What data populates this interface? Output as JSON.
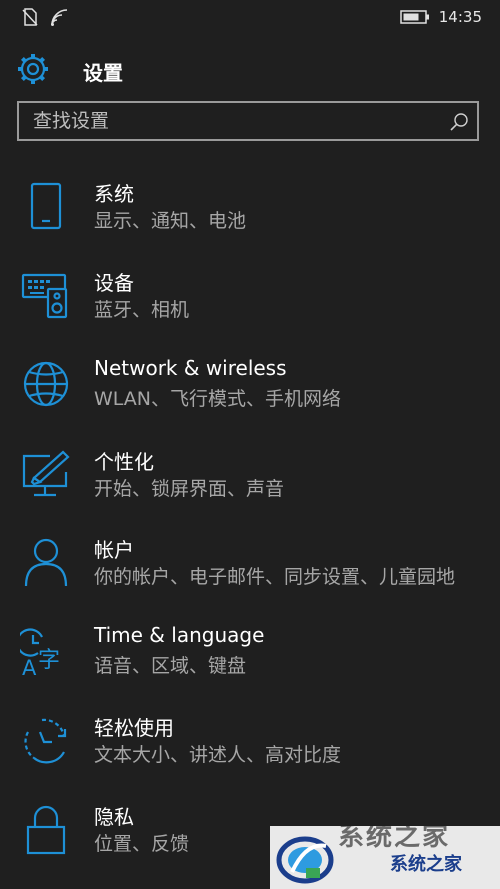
{
  "status_bar": {
    "time": "14:35",
    "icons": [
      "no-sim-icon",
      "wifi-icon",
      "battery-icon"
    ]
  },
  "header": {
    "title": "设置",
    "icon": "gear-icon"
  },
  "search": {
    "placeholder": "查找设置",
    "icon": "search-icon"
  },
  "accent_color": "#1e90d6",
  "items": [
    {
      "label": "系统",
      "sub": "显示、通知、电池",
      "icon": "phone-icon"
    },
    {
      "label": "设备",
      "sub": "蓝牙、相机",
      "icon": "devices-icon"
    },
    {
      "label": "Network & wireless",
      "sub": "WLAN、飞行模式、手机网络",
      "icon": "globe-icon"
    },
    {
      "label": "个性化",
      "sub": "开始、锁屏界面、声音",
      "icon": "personalize-icon"
    },
    {
      "label": "帐户",
      "sub": "你的帐户、电子邮件、同步设置、儿童园地",
      "icon": "person-icon"
    },
    {
      "label": "Time & language",
      "sub": "语音、区域、键盘",
      "icon": "time-language-icon"
    },
    {
      "label": "轻松使用",
      "sub": "文本大小、讲述人、高对比度",
      "icon": "ease-of-access-icon"
    },
    {
      "label": "隐私",
      "sub": "位置、反馈",
      "icon": "lock-icon"
    }
  ],
  "watermark": {
    "text": "系统之家",
    "ghost_text": "系统之家"
  }
}
